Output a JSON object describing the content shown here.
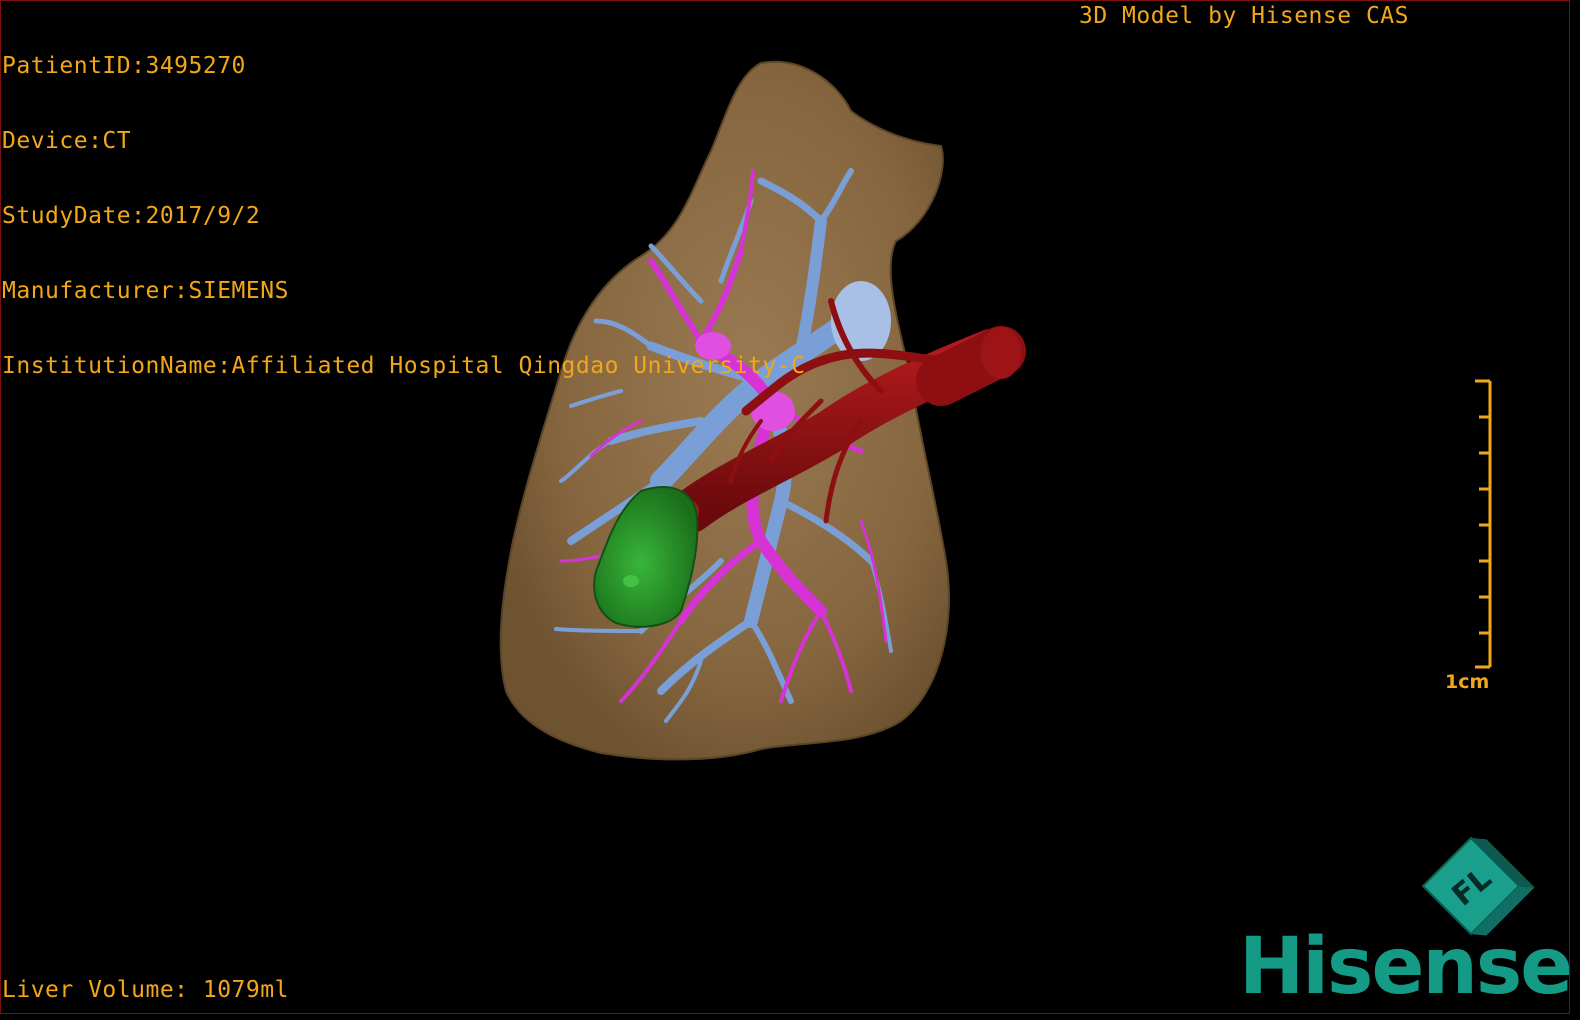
{
  "overlay": {
    "patient_id": "PatientID:3495270",
    "device": "Device:CT",
    "study_date": "StudyDate:2017/9/2",
    "manufacturer": "Manufacturer:SIEMENS",
    "institution": "InstitutionName:Affiliated Hospital Qingdao University-C",
    "credit": "3D Model by Hisense CAS",
    "liver_volume": "Liver Volume: 1079ml"
  },
  "scale": {
    "label": "1cm"
  },
  "logo": {
    "brand": "Hisense",
    "cube_letters": "FL"
  },
  "colors": {
    "text": "#f2a71a",
    "liver": "#8a6a45",
    "portal_vein": "#7a9fd6",
    "hepatic_vein": "#d632d6",
    "vena_cava": "#8e0f12",
    "lesion": "#1e8c1e",
    "brand": "#159a86"
  },
  "icons": [
    "orientation-cube-icon",
    "scale-ruler-icon",
    "brand-logo"
  ]
}
